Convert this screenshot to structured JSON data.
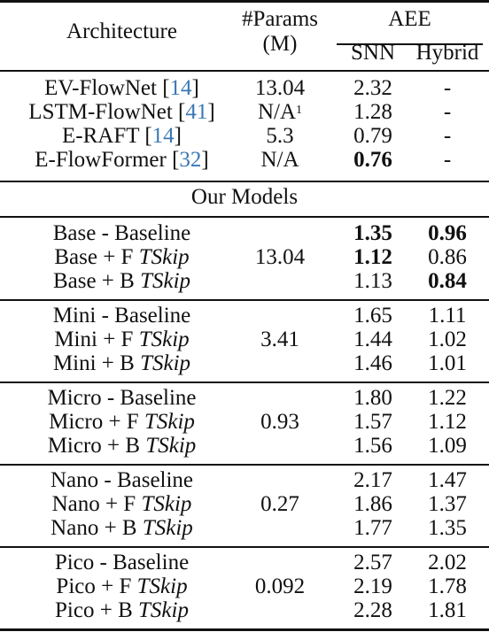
{
  "header": {
    "architecture": "Architecture",
    "params_line1": "#Params",
    "params_line2": "(M)",
    "aee": "AEE",
    "snn": "SNN",
    "hybrid": "Hybrid"
  },
  "link_color": "#3a78b5",
  "prior_work": [
    {
      "name": "EV-FlowNet",
      "cite": "14",
      "params": "13.04",
      "params_note": "",
      "snn": "2.32",
      "snn_bold": false,
      "hybrid": "-"
    },
    {
      "name": "LSTM-FlowNet",
      "cite": "41",
      "params": "N/A",
      "params_note": "1",
      "snn": "1.28",
      "snn_bold": false,
      "hybrid": "-"
    },
    {
      "name": "E-RAFT",
      "cite": "14",
      "params": "5.3",
      "params_note": "",
      "snn": "0.79",
      "snn_bold": false,
      "hybrid": "-"
    },
    {
      "name": "E-FlowFormer",
      "cite": "32",
      "params": "N/A",
      "params_note": "",
      "snn": "0.76",
      "snn_bold": true,
      "hybrid": "-"
    }
  ],
  "section_title": "Our Models",
  "groups": [
    {
      "params": "13.04",
      "rows": [
        {
          "prefix": "Base - Baseline",
          "tskip": "",
          "snn": "1.35",
          "snn_bold": true,
          "hybrid": "0.96",
          "hybrid_bold": true
        },
        {
          "prefix": "Base + F ",
          "tskip": "TSkip",
          "snn": "1.12",
          "snn_bold": true,
          "hybrid": "0.86",
          "hybrid_bold": false
        },
        {
          "prefix": "Base + B ",
          "tskip": "TSkip",
          "snn": "1.13",
          "snn_bold": false,
          "hybrid": "0.84",
          "hybrid_bold": true
        }
      ]
    },
    {
      "params": "3.41",
      "rows": [
        {
          "prefix": "Mini - Baseline",
          "tskip": "",
          "snn": "1.65",
          "snn_bold": false,
          "hybrid": "1.11",
          "hybrid_bold": false
        },
        {
          "prefix": "Mini + F ",
          "tskip": "TSkip",
          "snn": "1.44",
          "snn_bold": false,
          "hybrid": "1.02",
          "hybrid_bold": false
        },
        {
          "prefix": "Mini + B ",
          "tskip": "TSkip",
          "snn": "1.46",
          "snn_bold": false,
          "hybrid": "1.01",
          "hybrid_bold": false
        }
      ]
    },
    {
      "params": "0.93",
      "rows": [
        {
          "prefix": "Micro - Baseline",
          "tskip": "",
          "snn": "1.80",
          "snn_bold": false,
          "hybrid": "1.22",
          "hybrid_bold": false
        },
        {
          "prefix": "Micro + F ",
          "tskip": "TSkip",
          "snn": "1.57",
          "snn_bold": false,
          "hybrid": "1.12",
          "hybrid_bold": false
        },
        {
          "prefix": "Micro + B ",
          "tskip": "TSkip",
          "snn": "1.56",
          "snn_bold": false,
          "hybrid": "1.09",
          "hybrid_bold": false
        }
      ]
    },
    {
      "params": "0.27",
      "rows": [
        {
          "prefix": "Nano - Baseline",
          "tskip": "",
          "snn": "2.17",
          "snn_bold": false,
          "hybrid": "1.47",
          "hybrid_bold": false
        },
        {
          "prefix": "Nano + F ",
          "tskip": "TSkip",
          "snn": "1.86",
          "snn_bold": false,
          "hybrid": "1.37",
          "hybrid_bold": false
        },
        {
          "prefix": "Nano + B ",
          "tskip": "TSkip",
          "snn": "1.77",
          "snn_bold": false,
          "hybrid": "1.35",
          "hybrid_bold": false
        }
      ]
    },
    {
      "params": "0.092",
      "rows": [
        {
          "prefix": "Pico - Baseline",
          "tskip": "",
          "snn": "2.57",
          "snn_bold": false,
          "hybrid": "2.02",
          "hybrid_bold": false
        },
        {
          "prefix": "Pico + F ",
          "tskip": "TSkip",
          "snn": "2.19",
          "snn_bold": false,
          "hybrid": "1.78",
          "hybrid_bold": false
        },
        {
          "prefix": "Pico + B ",
          "tskip": "TSkip",
          "snn": "2.28",
          "snn_bold": false,
          "hybrid": "1.81",
          "hybrid_bold": false
        }
      ]
    }
  ]
}
